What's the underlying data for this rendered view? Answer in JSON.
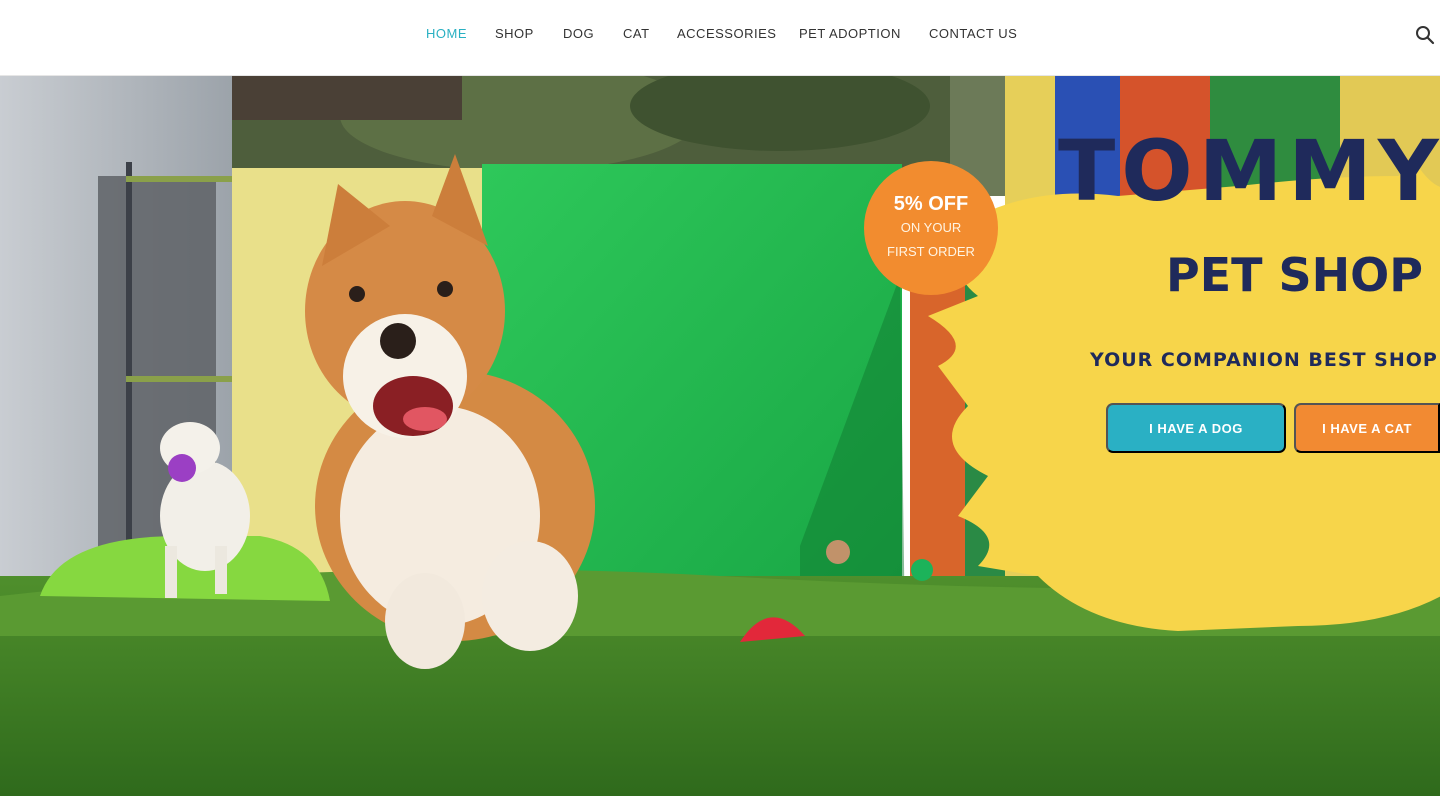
{
  "nav": {
    "items": [
      {
        "label": "HOME",
        "active": true
      },
      {
        "label": "SHOP",
        "active": false
      },
      {
        "label": "DOG",
        "active": false
      },
      {
        "label": "CAT",
        "active": false
      },
      {
        "label": "ACCESSORIES",
        "active": false
      },
      {
        "label": "PET ADOPTION",
        "active": false
      },
      {
        "label": "CONTACT US",
        "active": false
      }
    ],
    "search_icon": "search-icon"
  },
  "hero": {
    "badge": {
      "title": "5% OFF",
      "line1": "ON YOUR",
      "line2": "FIRST ORDER"
    },
    "brand_title": "TOMMY",
    "brand_subtitle": "PET SHOP",
    "tagline": "YOUR COMPANION BEST SHOP",
    "buttons": {
      "dog": "I HAVE A DOG",
      "cat": "I HAVE A CAT"
    }
  },
  "colors": {
    "accent_teal": "#29b0c2",
    "accent_orange": "#f28c2f",
    "brand_navy": "#1f2a5b",
    "brand_yellow": "#f7d54a"
  }
}
